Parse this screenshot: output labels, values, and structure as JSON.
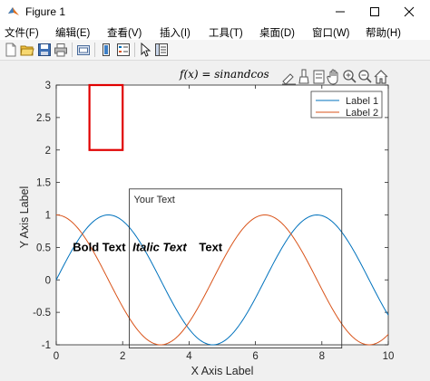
{
  "window": {
    "title": "Figure 1"
  },
  "menu": {
    "items": [
      "文件(F)",
      "编辑(E)",
      "查看(V)",
      "插入(I)",
      "工具(T)",
      "桌面(D)",
      "窗口(W)",
      "帮助(H)"
    ]
  },
  "toolbar": {
    "icons": [
      "new-figure-icon",
      "open-file-icon",
      "save-icon",
      "print-icon",
      "link-plot-icon",
      "insert-colorbar-icon",
      "insert-legend-icon",
      "edit-plot-icon",
      "property-inspector-icon"
    ]
  },
  "axes_toolbar": {
    "icons": [
      "data-tips-icon",
      "brush-icon",
      "restore-view-icon",
      "pan-icon",
      "zoom-in-icon",
      "zoom-out-icon",
      "home-icon"
    ]
  },
  "figure": {
    "formula_title": "f(x) = sinandcos",
    "xlabel": "X Axis Label",
    "ylabel": "Y Axis Label",
    "bold_text": "Bold Text",
    "italic_text": "Italic Text",
    "plain_text": "Text",
    "textbox_text": "Your Text"
  },
  "chart_data": {
    "type": "line",
    "title": "f(x) = sinandcos",
    "xlabel": "X Axis Label",
    "ylabel": "Y Axis Label",
    "xlim": [
      0,
      10
    ],
    "ylim": [
      -1,
      3
    ],
    "xticks": [
      0,
      2,
      4,
      6,
      8,
      10
    ],
    "yticks": [
      -1,
      -0.5,
      0,
      0.5,
      1,
      1.5,
      2,
      2.5,
      3
    ],
    "grid": false,
    "legend_position": "top-right",
    "series": [
      {
        "name": "Label 1",
        "function": "sin(x)",
        "color": "#0072BD",
        "x": [
          0,
          1,
          1.571,
          2,
          3,
          3.142,
          4,
          4.712,
          5,
          6,
          6.283,
          7,
          7.854,
          8,
          9,
          9.425,
          10
        ],
        "y": [
          0,
          0.841,
          1,
          0.909,
          0.141,
          0,
          -0.757,
          -1,
          -0.959,
          -0.279,
          0,
          0.657,
          1,
          0.989,
          0.412,
          0,
          -0.544
        ]
      },
      {
        "name": "Label 2",
        "function": "cos(x)",
        "color": "#D95319",
        "x": [
          0,
          1,
          1.571,
          2,
          3,
          3.142,
          4,
          4.712,
          5,
          6,
          6.283,
          7,
          7.854,
          8,
          9,
          9.425,
          10
        ],
        "y": [
          1,
          0.54,
          0,
          -0.416,
          -0.99,
          -1,
          -0.654,
          0,
          0.284,
          0.96,
          1,
          0.754,
          0,
          -0.146,
          -0.911,
          -1,
          -0.839
        ]
      }
    ],
    "annotations": [
      {
        "type": "rectangle",
        "color": "#E00000",
        "x": [
          1,
          2
        ],
        "y": [
          2,
          3
        ]
      },
      {
        "type": "textbox",
        "text": "Your Text",
        "x": [
          2.2,
          8.6
        ],
        "y": [
          -1.05,
          1.4
        ]
      },
      {
        "type": "text",
        "text": "Bold Text",
        "weight": "bold",
        "x": 0.5,
        "y": 0.5
      },
      {
        "type": "text",
        "text": "Italic Text",
        "style": "bold-italic",
        "x": 2.3,
        "y": 0.5
      },
      {
        "type": "text",
        "text": "Text",
        "weight": "bold",
        "x": 4.3,
        "y": 0.5
      }
    ],
    "colors": {
      "series1": "#0072BD",
      "series2": "#D95319",
      "rectangle": "#E00000"
    }
  }
}
